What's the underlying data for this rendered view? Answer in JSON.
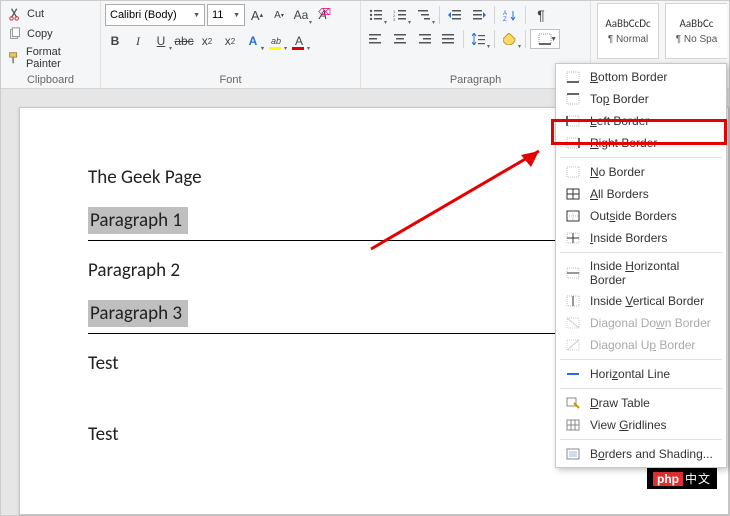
{
  "clipboard": {
    "cut": "Cut",
    "copy": "Copy",
    "format_painter": "Format Painter",
    "group_label": "Clipboard"
  },
  "font": {
    "name": "Calibri (Body)",
    "size": "11",
    "group_label": "Font"
  },
  "paragraph": {
    "group_label": "Paragraph"
  },
  "styles": {
    "preview": "AaBbCcDc",
    "normal": "¶ Normal",
    "preview2": "AaBbCc",
    "nospacing": "¶ No Spa"
  },
  "document": {
    "title": "The Geek Page",
    "p1": "Paragraph 1",
    "p2": "Paragraph 2",
    "p3": "Paragraph 3",
    "test1": "Test",
    "test2": "Test"
  },
  "border_menu": {
    "bottom": "ottom Border",
    "top": "p Border",
    "left": "eft Border",
    "right": "ight Border",
    "none": "o Border",
    "all": "ll Borders",
    "outside": "Out",
    "outside2": "ide Borders",
    "inside": "nside Borders",
    "inside_h": "Inside ",
    "inside_h2": "orizontal Border",
    "inside_v": "Inside ",
    "inside_v2": "ertical Border",
    "diag_down": "Diagonal Do",
    "diag_down2": "n Border",
    "diag_up": "Diagonal U",
    "diag_up2": " Border",
    "hline": "Hori",
    "hline2": "ontal Line",
    "draw": "raw Table",
    "gridlines": "View ",
    "gridlines2": "ridlines",
    "shading": "B",
    "shading2": "rders and Shading..."
  },
  "watermark": {
    "php": "php",
    "cn": "中文"
  }
}
